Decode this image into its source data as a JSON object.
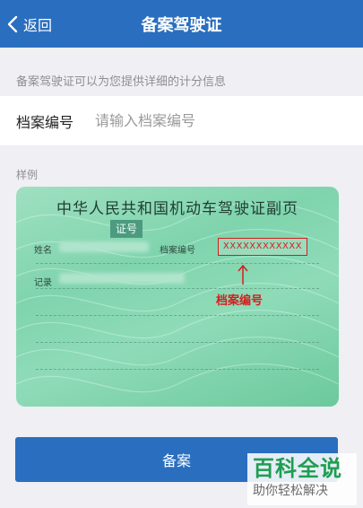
{
  "nav": {
    "back_label": "返回",
    "title": "备案驾驶证"
  },
  "hint": "备案驾驶证可以为您提供详细的计分信息",
  "form": {
    "field_label": "档案编号",
    "field_placeholder": "请输入档案编号",
    "field_value": ""
  },
  "sample": {
    "label": "样例",
    "card_title": "中华人民共和国机动车驾驶证副页",
    "card_tag": "证号",
    "name_key": "姓名",
    "file_no_key": "档案编号",
    "record_key": "记录",
    "file_no_value": "XXXXXXXXXXXX",
    "annotation": "档案编号",
    "annotation_color": "#d21f1f"
  },
  "submit_label": "备案",
  "watermark": {
    "brand": "百科全说",
    "slogan": "助你轻松解决"
  },
  "colors": {
    "primary": "#2a6ebf",
    "background": "#efeff4"
  }
}
